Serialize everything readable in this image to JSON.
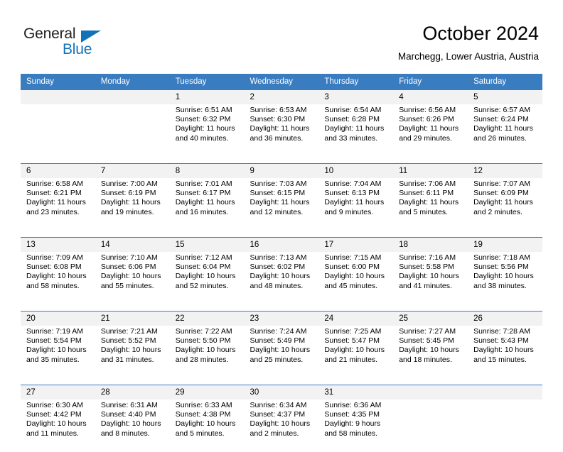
{
  "brand": {
    "name_part1": "General",
    "name_part2": "Blue",
    "accent_color": "#1272b8"
  },
  "header": {
    "month_title": "October 2024",
    "location": "Marchegg, Lower Austria, Austria"
  },
  "theme": {
    "header_row_bg": "#3a7cc0",
    "daynum_bg": "#f2f2f2",
    "cell_bg": "#ffffff"
  },
  "weekday_headers": [
    "Sunday",
    "Monday",
    "Tuesday",
    "Wednesday",
    "Thursday",
    "Friday",
    "Saturday"
  ],
  "weeks": [
    [
      {
        "day": "",
        "lines": [
          "",
          "",
          "",
          ""
        ]
      },
      {
        "day": "",
        "lines": [
          "",
          "",
          "",
          ""
        ]
      },
      {
        "day": "1",
        "lines": [
          "Sunrise: 6:51 AM",
          "Sunset: 6:32 PM",
          "Daylight: 11 hours",
          "and 40 minutes."
        ]
      },
      {
        "day": "2",
        "lines": [
          "Sunrise: 6:53 AM",
          "Sunset: 6:30 PM",
          "Daylight: 11 hours",
          "and 36 minutes."
        ]
      },
      {
        "day": "3",
        "lines": [
          "Sunrise: 6:54 AM",
          "Sunset: 6:28 PM",
          "Daylight: 11 hours",
          "and 33 minutes."
        ]
      },
      {
        "day": "4",
        "lines": [
          "Sunrise: 6:56 AM",
          "Sunset: 6:26 PM",
          "Daylight: 11 hours",
          "and 29 minutes."
        ]
      },
      {
        "day": "5",
        "lines": [
          "Sunrise: 6:57 AM",
          "Sunset: 6:24 PM",
          "Daylight: 11 hours",
          "and 26 minutes."
        ]
      }
    ],
    [
      {
        "day": "6",
        "lines": [
          "Sunrise: 6:58 AM",
          "Sunset: 6:21 PM",
          "Daylight: 11 hours",
          "and 23 minutes."
        ]
      },
      {
        "day": "7",
        "lines": [
          "Sunrise: 7:00 AM",
          "Sunset: 6:19 PM",
          "Daylight: 11 hours",
          "and 19 minutes."
        ]
      },
      {
        "day": "8",
        "lines": [
          "Sunrise: 7:01 AM",
          "Sunset: 6:17 PM",
          "Daylight: 11 hours",
          "and 16 minutes."
        ]
      },
      {
        "day": "9",
        "lines": [
          "Sunrise: 7:03 AM",
          "Sunset: 6:15 PM",
          "Daylight: 11 hours",
          "and 12 minutes."
        ]
      },
      {
        "day": "10",
        "lines": [
          "Sunrise: 7:04 AM",
          "Sunset: 6:13 PM",
          "Daylight: 11 hours",
          "and 9 minutes."
        ]
      },
      {
        "day": "11",
        "lines": [
          "Sunrise: 7:06 AM",
          "Sunset: 6:11 PM",
          "Daylight: 11 hours",
          "and 5 minutes."
        ]
      },
      {
        "day": "12",
        "lines": [
          "Sunrise: 7:07 AM",
          "Sunset: 6:09 PM",
          "Daylight: 11 hours",
          "and 2 minutes."
        ]
      }
    ],
    [
      {
        "day": "13",
        "lines": [
          "Sunrise: 7:09 AM",
          "Sunset: 6:08 PM",
          "Daylight: 10 hours",
          "and 58 minutes."
        ]
      },
      {
        "day": "14",
        "lines": [
          "Sunrise: 7:10 AM",
          "Sunset: 6:06 PM",
          "Daylight: 10 hours",
          "and 55 minutes."
        ]
      },
      {
        "day": "15",
        "lines": [
          "Sunrise: 7:12 AM",
          "Sunset: 6:04 PM",
          "Daylight: 10 hours",
          "and 52 minutes."
        ]
      },
      {
        "day": "16",
        "lines": [
          "Sunrise: 7:13 AM",
          "Sunset: 6:02 PM",
          "Daylight: 10 hours",
          "and 48 minutes."
        ]
      },
      {
        "day": "17",
        "lines": [
          "Sunrise: 7:15 AM",
          "Sunset: 6:00 PM",
          "Daylight: 10 hours",
          "and 45 minutes."
        ]
      },
      {
        "day": "18",
        "lines": [
          "Sunrise: 7:16 AM",
          "Sunset: 5:58 PM",
          "Daylight: 10 hours",
          "and 41 minutes."
        ]
      },
      {
        "day": "19",
        "lines": [
          "Sunrise: 7:18 AM",
          "Sunset: 5:56 PM",
          "Daylight: 10 hours",
          "and 38 minutes."
        ]
      }
    ],
    [
      {
        "day": "20",
        "lines": [
          "Sunrise: 7:19 AM",
          "Sunset: 5:54 PM",
          "Daylight: 10 hours",
          "and 35 minutes."
        ]
      },
      {
        "day": "21",
        "lines": [
          "Sunrise: 7:21 AM",
          "Sunset: 5:52 PM",
          "Daylight: 10 hours",
          "and 31 minutes."
        ]
      },
      {
        "day": "22",
        "lines": [
          "Sunrise: 7:22 AM",
          "Sunset: 5:50 PM",
          "Daylight: 10 hours",
          "and 28 minutes."
        ]
      },
      {
        "day": "23",
        "lines": [
          "Sunrise: 7:24 AM",
          "Sunset: 5:49 PM",
          "Daylight: 10 hours",
          "and 25 minutes."
        ]
      },
      {
        "day": "24",
        "lines": [
          "Sunrise: 7:25 AM",
          "Sunset: 5:47 PM",
          "Daylight: 10 hours",
          "and 21 minutes."
        ]
      },
      {
        "day": "25",
        "lines": [
          "Sunrise: 7:27 AM",
          "Sunset: 5:45 PM",
          "Daylight: 10 hours",
          "and 18 minutes."
        ]
      },
      {
        "day": "26",
        "lines": [
          "Sunrise: 7:28 AM",
          "Sunset: 5:43 PM",
          "Daylight: 10 hours",
          "and 15 minutes."
        ]
      }
    ],
    [
      {
        "day": "27",
        "lines": [
          "Sunrise: 6:30 AM",
          "Sunset: 4:42 PM",
          "Daylight: 10 hours",
          "and 11 minutes."
        ]
      },
      {
        "day": "28",
        "lines": [
          "Sunrise: 6:31 AM",
          "Sunset: 4:40 PM",
          "Daylight: 10 hours",
          "and 8 minutes."
        ]
      },
      {
        "day": "29",
        "lines": [
          "Sunrise: 6:33 AM",
          "Sunset: 4:38 PM",
          "Daylight: 10 hours",
          "and 5 minutes."
        ]
      },
      {
        "day": "30",
        "lines": [
          "Sunrise: 6:34 AM",
          "Sunset: 4:37 PM",
          "Daylight: 10 hours",
          "and 2 minutes."
        ]
      },
      {
        "day": "31",
        "lines": [
          "Sunrise: 6:36 AM",
          "Sunset: 4:35 PM",
          "Daylight: 9 hours",
          "and 58 minutes."
        ]
      },
      {
        "day": "",
        "lines": [
          "",
          "",
          "",
          ""
        ]
      },
      {
        "day": "",
        "lines": [
          "",
          "",
          "",
          ""
        ]
      }
    ]
  ]
}
